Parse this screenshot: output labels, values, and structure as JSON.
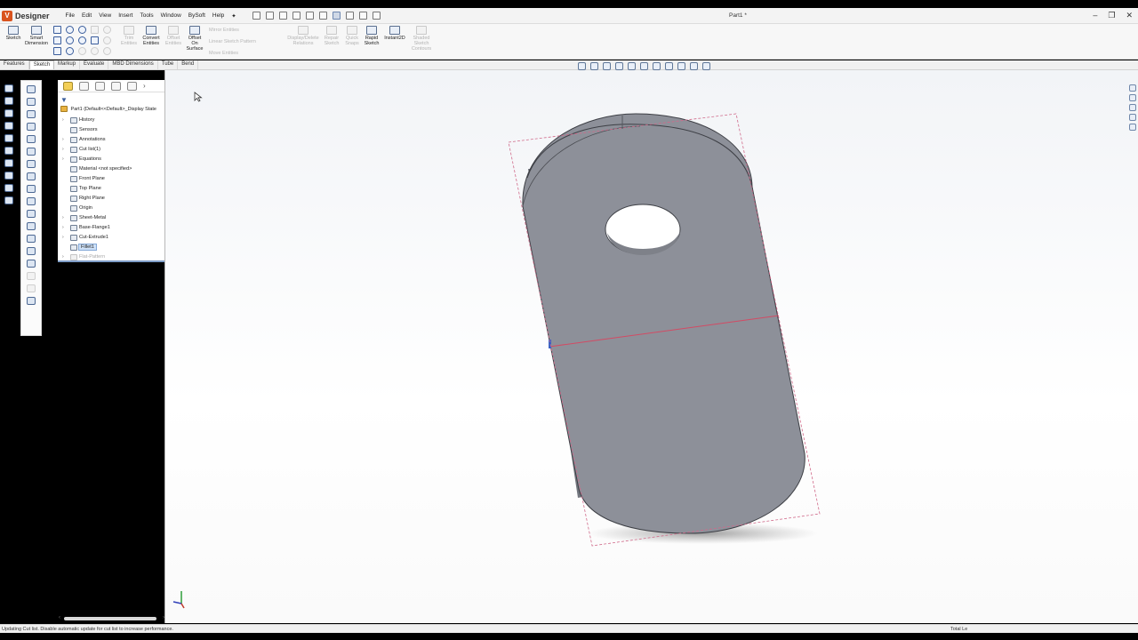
{
  "app": {
    "name": "Designer",
    "document_title": "Part1 *"
  },
  "menu": [
    "File",
    "Edit",
    "View",
    "Insert",
    "Tools",
    "Window",
    "BySoft",
    "Help"
  ],
  "commands": {
    "sketch": "Sketch",
    "smart_dimension": "Smart\nDimension",
    "trim_entities": "Trim\nEntities",
    "convert_entities": "Convert\nEntities",
    "offset_entities": "Offset\nEntities",
    "offset_on_surface": "Offset\nOn\nSurface",
    "mirror_entities": "Mirror Entities",
    "linear_sketch_pattern": "Linear Sketch Pattern",
    "move_entities": "Move Entities",
    "display_delete_relations": "Display/Delete\nRelations",
    "repair_sketch": "Repair\nSketch",
    "quick_snaps": "Quick\nSnaps",
    "rapid_sketch": "Rapid\nSketch",
    "instant2d": "Instant2D",
    "shaded_sketch_contours": "Shaded\nSketch\nContours"
  },
  "tabs": [
    "Features",
    "Sketch",
    "Markup",
    "Evaluate",
    "MBD Dimensions",
    "Tube",
    "Bend"
  ],
  "active_tab": "Sketch",
  "feature_tree": {
    "root": "Part1 (Default<<Default>_Display State",
    "nodes": [
      {
        "label": "History",
        "expandable": true
      },
      {
        "label": "Sensors",
        "expandable": false
      },
      {
        "label": "Annotations",
        "expandable": true
      },
      {
        "label": "Cut list(1)",
        "expandable": true
      },
      {
        "label": "Equations",
        "expandable": true
      },
      {
        "label": "Material <not specified>",
        "expandable": false
      },
      {
        "label": "Front Plane",
        "expandable": false
      },
      {
        "label": "Top Plane",
        "expandable": false
      },
      {
        "label": "Right Plane",
        "expandable": false
      },
      {
        "label": "Origin",
        "expandable": false
      },
      {
        "label": "Sheet-Metal",
        "expandable": true
      },
      {
        "label": "Base-Flange1",
        "expandable": true
      },
      {
        "label": "Cut-Extrude1",
        "expandable": true
      },
      {
        "label": "Fillet1",
        "expandable": false,
        "selected": true
      },
      {
        "label": "Flat-Pattern",
        "expandable": true,
        "suppressed": true
      }
    ]
  },
  "status": {
    "message": "Updating Cut list. Disable automatic update for cut list to increase performance.",
    "right": "Total Le"
  },
  "colors": {
    "part_face": "#8d9099",
    "part_side": "#7a7d86",
    "selection_outline": "#d06a8a",
    "accent": "#d9531e"
  }
}
